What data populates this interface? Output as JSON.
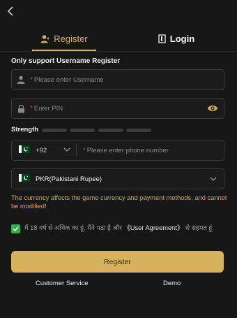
{
  "nav": {
    "back_icon": "chevron-left-icon"
  },
  "tabs": [
    {
      "label": "Register",
      "icon": "user-icon",
      "active": true
    },
    {
      "label": "Login",
      "icon": "login-door-icon",
      "active": false
    }
  ],
  "form": {
    "section_label": "Only support Username Register",
    "username": {
      "placeholder": "Please enter Username",
      "required_mark": "*"
    },
    "pin": {
      "placeholder": "Enter PIN",
      "required_mark": "*"
    },
    "strength": {
      "label": "Strength",
      "level": 0,
      "segments": 4
    },
    "phone": {
      "country_code": "+92",
      "placeholder": "Please enter phone number",
      "required_mark": "*"
    },
    "currency": {
      "value": "PKR(Pakistani Rupee)"
    },
    "warning": "The currency affects the game currency and payment methods, and cannot be modified!",
    "agreement": {
      "checked": true,
      "text_before": "मैं 18 वर्ष से अधिक का हूं, मैंने पढ़ा है और ",
      "link": "《User Agreement》",
      "text_after": " से सहमत हूं"
    },
    "submit_label": "Register"
  },
  "footer": {
    "customer_service": "Customer Service",
    "demo": "Demo"
  },
  "colors": {
    "background": "#171717",
    "accent": "#d6b25a",
    "warning": "#f0a020",
    "checkbox": "#2cb24a",
    "required": "#e53935"
  }
}
